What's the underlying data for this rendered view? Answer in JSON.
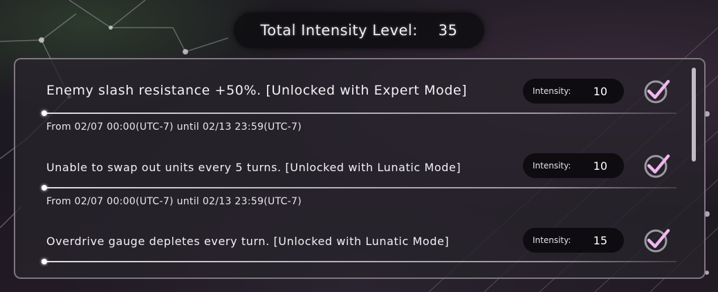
{
  "header": {
    "total_label": "Total Intensity Level:",
    "total_value": "35"
  },
  "conditions": [
    {
      "description": "Enemy slash resistance +50%. [Unlocked with Expert Mode]",
      "intensity_label": "Intensity:",
      "intensity_value": "10",
      "checked": true,
      "period": "From 02/07 00:00(UTC-7) until 02/13 23:59(UTC-7)"
    },
    {
      "description": "Unable to swap out units every 5 turns. [Unlocked with Lunatic Mode]",
      "intensity_label": "Intensity:",
      "intensity_value": "10",
      "checked": true,
      "period": "From 02/07 00:00(UTC-7) until 02/13 23:59(UTC-7)"
    },
    {
      "description": "Overdrive gauge depletes every turn. [Unlocked with Lunatic Mode]",
      "intensity_label": "Intensity:",
      "intensity_value": "15",
      "checked": true
    }
  ],
  "colors": {
    "accent_check": "#e8a0e8",
    "pill_bg": "#0e0c10",
    "panel_border": "#c8bec8"
  },
  "icons": {
    "checkbox": "checkmark-icon"
  }
}
